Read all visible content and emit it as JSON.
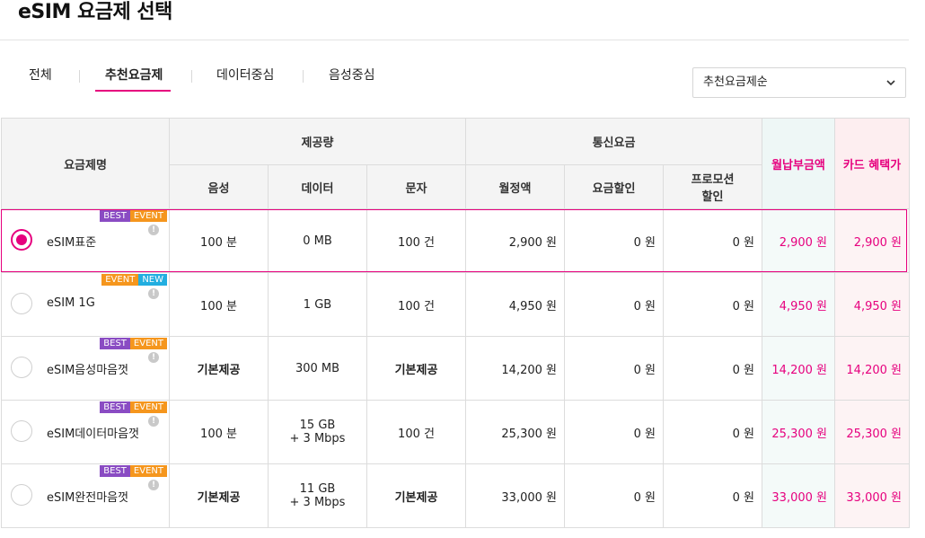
{
  "title": "eSIM 요금제 선택",
  "tabs": [
    {
      "label": "전체"
    },
    {
      "label": "추천요금제"
    },
    {
      "label": "데이터중심"
    },
    {
      "label": "음성중심"
    }
  ],
  "active_tab": "추천요금제",
  "sort": {
    "value": "추천요금제순"
  },
  "table": {
    "headers": {
      "plan": "요금제명",
      "provided": "제공량",
      "fee": "통신요금",
      "bill": "월납부금액",
      "card": "카드 혜택가",
      "voice": "음성",
      "data": "데이터",
      "sms": "문자",
      "monthly": "월정액",
      "discount": "요금할인",
      "promo_line1": "프로모션",
      "promo_line2": "할인"
    },
    "rows": [
      {
        "name": "eSIM표준",
        "badges": [
          "BEST",
          "EVENT"
        ],
        "selected": true,
        "voice": "100 분",
        "data1": "0 MB",
        "data2": "",
        "sms": "100 건",
        "monthly": "2,900 원",
        "discount": "0 원",
        "promo": "0 원",
        "bill": "2,900 원",
        "card": "2,900 원"
      },
      {
        "name": "eSIM 1G",
        "badges": [
          "EVENT",
          "NEW"
        ],
        "selected": false,
        "voice": "100 분",
        "data1": "1 GB",
        "data2": "",
        "sms": "100 건",
        "monthly": "4,950 원",
        "discount": "0 원",
        "promo": "0 원",
        "bill": "4,950 원",
        "card": "4,950 원"
      },
      {
        "name": "eSIM음성마음껏",
        "badges": [
          "BEST",
          "EVENT"
        ],
        "selected": false,
        "voice": "기본제공",
        "data1": "300 MB",
        "data2": "",
        "sms": "기본제공",
        "monthly": "14,200 원",
        "discount": "0 원",
        "promo": "0 원",
        "bill": "14,200 원",
        "card": "14,200 원"
      },
      {
        "name": "eSIM데이터마음껏",
        "badges": [
          "BEST",
          "EVENT"
        ],
        "selected": false,
        "voice": "100 분",
        "data1": "15 GB",
        "data2": "+ 3 Mbps",
        "sms": "100 건",
        "monthly": "25,300 원",
        "discount": "0 원",
        "promo": "0 원",
        "bill": "25,300 원",
        "card": "25,300 원"
      },
      {
        "name": "eSIM완전마음껏",
        "badges": [
          "BEST",
          "EVENT"
        ],
        "selected": false,
        "voice": "기본제공",
        "data1": "11 GB",
        "data2": "+ 3 Mbps",
        "sms": "기본제공",
        "monthly": "33,000 원",
        "discount": "0 원",
        "promo": "0 원",
        "bill": "33,000 원",
        "card": "33,000 원"
      }
    ]
  },
  "colors": {
    "accent": "#e6007e",
    "best": "#8a4cc3",
    "event": "#f5961d",
    "new": "#22aee0"
  }
}
